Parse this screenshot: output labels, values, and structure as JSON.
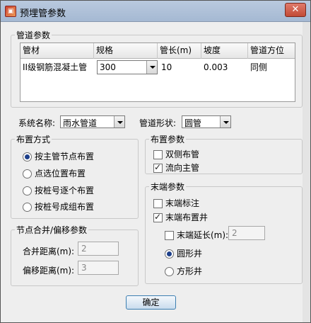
{
  "window": {
    "title": "预埋管参数",
    "close_label": "✕"
  },
  "pipe_params": {
    "group_title": "管道参数",
    "columns": [
      "管材",
      "规格",
      "管长(m)",
      "坡度",
      "管道方位"
    ],
    "rows": [
      {
        "material": "II级钢筋混凝土管",
        "spec": "300",
        "length": "10",
        "slope": "0.003",
        "orientation": "同侧"
      }
    ]
  },
  "system": {
    "label": "系统名称:",
    "value": "雨水管道"
  },
  "shape": {
    "label": "管道形状:",
    "value": "圆管"
  },
  "layout_mode": {
    "group_title": "布置方式",
    "options": [
      "按主管节点布置",
      "点选位置布置",
      "按桩号逐个布置",
      "按桩号成组布置"
    ],
    "selected_index": 0
  },
  "layout_params": {
    "group_title": "布置参数",
    "double_side": {
      "label": "双侧布管",
      "checked": false
    },
    "flow_direction": {
      "label": "流向主管",
      "checked": true
    }
  },
  "node_merge": {
    "group_title": "节点合并/偏移参数",
    "merge_distance": {
      "label": "合并距离(m):",
      "value": "2"
    },
    "offset_distance": {
      "label": "偏移距离(m):",
      "value": "3"
    }
  },
  "end_params": {
    "group_title": "末端参数",
    "end_mark": {
      "label": "末端标注",
      "checked": false
    },
    "end_well": {
      "label": "末端布置井",
      "checked": true
    },
    "end_extend": {
      "label": "末端延长(m):",
      "checked": false,
      "value": "2"
    },
    "well_shapes": [
      "圆形井",
      "方形井"
    ],
    "well_selected_index": 0
  },
  "ok_label": "确定"
}
